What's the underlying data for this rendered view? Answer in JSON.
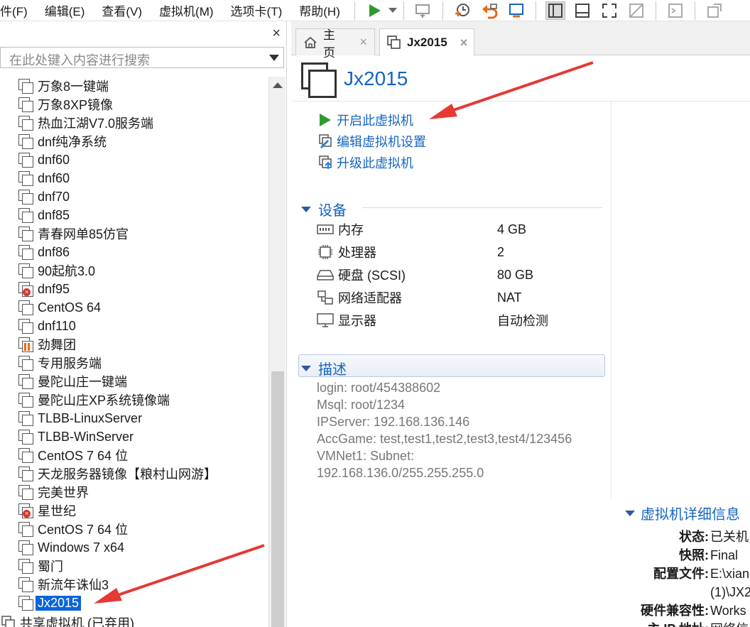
{
  "menu": {
    "items": [
      "件(F)",
      "编辑(E)",
      "查看(V)",
      "虚拟机(M)",
      "选项卡(T)",
      "帮助(H)"
    ]
  },
  "toolbar": {
    "icons": [
      "play-icon",
      "dropdown-icon",
      "send-keys-icon",
      "snapshot-icon",
      "revert-snapshot-icon",
      "manage-snapshots-icon",
      "show-library-icon",
      "thumbnail-bar-icon",
      "fullscreen-icon",
      "unity-icon",
      "console-view-icon",
      "stretch-icon"
    ]
  },
  "library": {
    "close": "×",
    "search_placeholder": "在此处键入内容进行搜索",
    "items": [
      {
        "label": "万象8一键端",
        "status": "normal"
      },
      {
        "label": "万象8XP镜像",
        "status": "normal"
      },
      {
        "label": "热血江湖V7.0服务端",
        "status": "normal"
      },
      {
        "label": "dnf纯净系统",
        "status": "normal"
      },
      {
        "label": "dnf60",
        "status": "normal"
      },
      {
        "label": "dnf60",
        "status": "normal"
      },
      {
        "label": "dnf70",
        "status": "normal"
      },
      {
        "label": "dnf85",
        "status": "normal"
      },
      {
        "label": "青春网单85仿官",
        "status": "normal"
      },
      {
        "label": "dnf86",
        "status": "normal"
      },
      {
        "label": "90起航3.0",
        "status": "normal"
      },
      {
        "label": "dnf95",
        "status": "error"
      },
      {
        "label": "CentOS 64",
        "status": "normal"
      },
      {
        "label": "dnf110",
        "status": "normal"
      },
      {
        "label": "劲舞团",
        "status": "paused"
      },
      {
        "label": "专用服务端",
        "status": "normal"
      },
      {
        "label": "曼陀山庄一键端",
        "status": "normal"
      },
      {
        "label": "曼陀山庄XP系统镜像端",
        "status": "normal"
      },
      {
        "label": "TLBB-LinuxServer",
        "status": "normal"
      },
      {
        "label": "TLBB-WinServer",
        "status": "normal"
      },
      {
        "label": "CentOS 7 64 位",
        "status": "normal"
      },
      {
        "label": "天龙服务器镜像【粮村山网游】",
        "status": "normal"
      },
      {
        "label": "完美世界",
        "status": "normal"
      },
      {
        "label": "星世纪",
        "status": "error"
      },
      {
        "label": "CentOS 7 64 位",
        "status": "normal"
      },
      {
        "label": "Windows 7 x64",
        "status": "normal"
      },
      {
        "label": "蜀门",
        "status": "normal"
      },
      {
        "label": "新流年诛仙3",
        "status": "normal"
      },
      {
        "label": "Jx2015",
        "status": "selected"
      }
    ],
    "shared_label": "共享虚拟机 (已弃用)"
  },
  "tabs": [
    {
      "label": "主页",
      "icon": "home-icon",
      "close": "×"
    },
    {
      "label": "Jx2015",
      "icon": "vm-icon",
      "close": "×"
    }
  ],
  "vm": {
    "title": "Jx2015",
    "actions": {
      "power_on": "开启此虚拟机",
      "edit_settings": "编辑虚拟机设置",
      "upgrade": "升级此虚拟机"
    },
    "devices_heading": "设备",
    "devices": [
      {
        "name": "内存",
        "value": "4 GB",
        "icon": "memory-icon"
      },
      {
        "name": "处理器",
        "value": "2",
        "icon": "cpu-icon"
      },
      {
        "name": "硬盘 (SCSI)",
        "value": "80 GB",
        "icon": "harddisk-icon"
      },
      {
        "name": "网络适配器",
        "value": "NAT",
        "icon": "network-adapter-icon"
      },
      {
        "name": "显示器",
        "value": "自动检测",
        "icon": "display-icon"
      }
    ],
    "description_heading": "描述",
    "description": [
      "login: root/454388602",
      "Msql: root/1234",
      "IPServer: 192.168.136.146",
      "AccGame: test,test1,test2,test3,test4/123456",
      "VMNet1: Subnet:",
      "192.168.136.0/255.255.255.0"
    ],
    "details_heading": "虚拟机详细信息",
    "details": [
      {
        "key": "状态:",
        "value": "已关机"
      },
      {
        "key": "快照:",
        "value": "Final"
      },
      {
        "key": "配置文件:",
        "value": "E:\\xian"
      },
      {
        "key": "",
        "value": "(1)\\JX2"
      },
      {
        "key": "硬件兼容性:",
        "value": "Works"
      },
      {
        "key": "主 IP 地址:",
        "value": "网络信"
      }
    ]
  },
  "colors": {
    "accent_blue": "#1565c0",
    "selection": "#0a64d8",
    "annotation_arrow": "#e53935",
    "play_green": "#2e9a2e"
  }
}
